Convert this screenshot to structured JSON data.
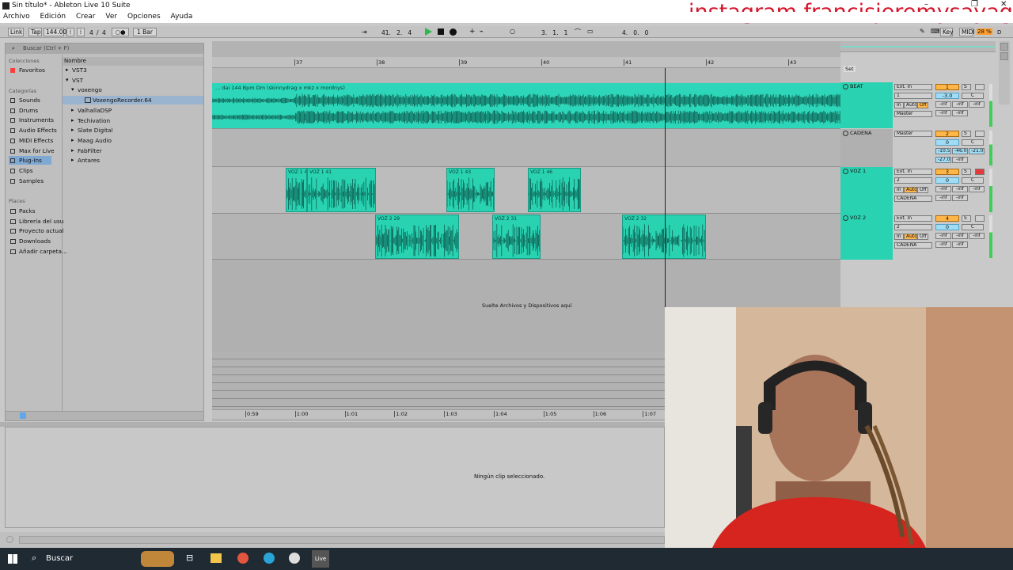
{
  "window": {
    "title": "Sin título* - Ableton Live 10 Suite",
    "controls": [
      "–",
      "❐",
      "✕"
    ]
  },
  "overlay": {
    "text": "instagram francisjeremysayago"
  },
  "menu": [
    "Archivo",
    "Edición",
    "Crear",
    "Ver",
    "Opciones",
    "Ayuda"
  ],
  "control_bar": {
    "link": "Link",
    "tap": "Tap",
    "tempo": "144.00",
    "time_sig_num": "4",
    "time_sig_den": "4",
    "quantize": "1 Bar",
    "position": "41.   2.   4",
    "loop_start": "3.   1.   1",
    "loop_length": "4.   0.   0",
    "key": "Key",
    "midi": "MIDI",
    "cpu": "28 %",
    "disk": "D"
  },
  "browser": {
    "search_placeholder": "Buscar (Ctrl + F)",
    "collections_title": "Colecciones",
    "favorites": "Favoritos",
    "categories_title": "Categorías",
    "categories": [
      "Sounds",
      "Drums",
      "Instruments",
      "Audio Effects",
      "MIDI Effects",
      "Max for Live",
      "Plug-Ins",
      "Clips",
      "Samples"
    ],
    "places_title": "Places",
    "places": [
      "Packs",
      "Librería del usu",
      "Proyecto actual",
      "Downloads",
      "Añadir carpeta..."
    ],
    "column_header": "Nombre",
    "tree": [
      {
        "label": "VST3",
        "indent": 0,
        "arrow": "▸"
      },
      {
        "label": "VST",
        "indent": 0,
        "arrow": "▾"
      },
      {
        "label": "voxengo",
        "indent": 1,
        "arrow": "▾"
      },
      {
        "label": "VoxengoRecorder.64",
        "indent": 2,
        "arrow": ""
      },
      {
        "label": "ValhallaDSP",
        "indent": 1,
        "arrow": "▸"
      },
      {
        "label": "Techivation",
        "indent": 1,
        "arrow": "▸"
      },
      {
        "label": "Slate Digital",
        "indent": 1,
        "arrow": "▸"
      },
      {
        "label": "Maag Audio",
        "indent": 1,
        "arrow": "▸"
      },
      {
        "label": "FabFilter",
        "indent": 1,
        "arrow": "▸"
      },
      {
        "label": "Antares",
        "indent": 1,
        "arrow": "▸"
      }
    ]
  },
  "arrangement": {
    "bar_ruler": [
      "37",
      "38",
      "39",
      "40",
      "41",
      "42",
      "43"
    ],
    "time_ruler": [
      "0:59",
      "1:00",
      "1:01",
      "1:02",
      "1:03",
      "1:04",
      "1:05",
      "1:06",
      "1:07"
    ],
    "beat_clip": "... dai 144 Bpm Dm (skinnydrag x mkz x mordnys)",
    "voz1_clips": [
      "VOZ 1 4",
      "VOZ 1 41",
      "VOZ 1 43",
      "VOZ 1 46"
    ],
    "voz2_clips": [
      "VOZ 2 29",
      "VOZ 2 31",
      "VOZ 2 32"
    ],
    "drop_text": "Suelte Archivos y Dispositivos aquí"
  },
  "set_label": "Set",
  "tracks": [
    {
      "name": "BEAT",
      "input": "Ext. In",
      "channel": "1",
      "monitor": [
        "In",
        "Auto",
        "Off"
      ],
      "output": "Master",
      "number": "1",
      "volume": "-3.0",
      "pan": "C",
      "sends": [
        "-inf",
        "-inf",
        "-inf"
      ],
      "extra": [
        "-inf",
        "-inf"
      ],
      "armed": false,
      "color": "#29d3b2"
    },
    {
      "name": "CADENA",
      "input": "Master",
      "volume": "0",
      "pan": "C",
      "sends": [
        "-10.5",
        "-46.0",
        "-21.0"
      ],
      "extra": [
        "-27.0",
        "-inf"
      ],
      "number": "2",
      "armed": false,
      "color": "#b0b0b0"
    },
    {
      "name": "VOZ 1",
      "input": "Ext. In",
      "channel": "2",
      "monitor": [
        "In",
        "Auto",
        "Off"
      ],
      "output": "CADENA",
      "number": "3",
      "volume": "0",
      "pan": "C",
      "sends": [
        "-inf",
        "-inf",
        "-inf"
      ],
      "extra": [
        "-inf",
        "-inf"
      ],
      "armed": true,
      "color": "#29d3b2"
    },
    {
      "name": "VOZ 2",
      "input": "Ext. In",
      "channel": "2",
      "monitor": [
        "In",
        "Auto",
        "Off"
      ],
      "output": "CADENA",
      "number": "4",
      "volume": "0",
      "pan": "C",
      "sends": [
        "-inf",
        "-inf",
        "-inf"
      ],
      "extra": [
        "-inf",
        "-inf"
      ],
      "armed": false,
      "color": "#29d3b2"
    }
  ],
  "detail": {
    "text": "Ningún clip seleccionado."
  },
  "taskbar": {
    "search": "Buscar",
    "live_label": "Live"
  }
}
